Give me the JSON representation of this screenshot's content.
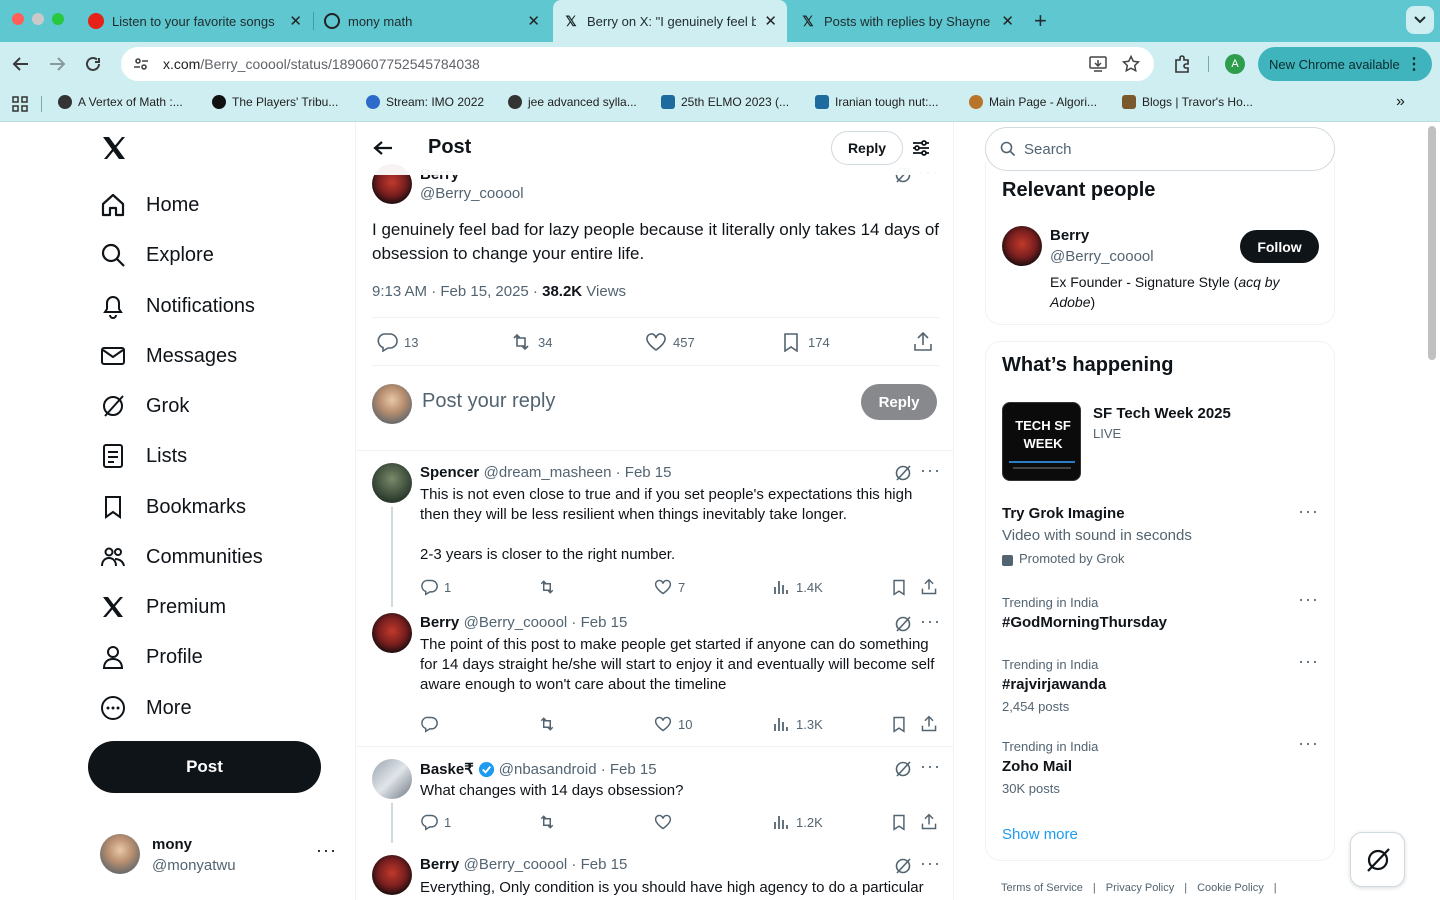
{
  "browser": {
    "tabs": [
      {
        "title": "Listen to your favorite songs"
      },
      {
        "title": "mony math"
      },
      {
        "title": "Berry on X: \"I genuinely feel b"
      },
      {
        "title": "Posts with replies by Shayne"
      }
    ],
    "url_host": "x.com",
    "url_path": "/Berry_cooool/status/1890607752545784038",
    "new_chrome_label": "New Chrome available",
    "profile_initial": "A",
    "bookmarks": [
      "A Vertex of Math :...",
      "The Players' Tribu...",
      "Stream: IMO 2022",
      "jee advanced sylla...",
      "25th ELMO 2023 (...",
      "Iranian tough nut:...",
      "Main Page - Algori...",
      "Blogs | Travor's Ho..."
    ]
  },
  "nav": {
    "items": [
      "Home",
      "Explore",
      "Notifications",
      "Messages",
      "Grok",
      "Lists",
      "Bookmarks",
      "Communities",
      "Premium",
      "Profile",
      "More"
    ],
    "post_label": "Post",
    "account_name": "mony",
    "account_handle": "@monyatwu"
  },
  "main": {
    "header_title": "Post",
    "header_reply": "Reply",
    "author_name": "Berry",
    "author_handle": "@Berry_cooool",
    "text": "I genuinely feel bad for lazy people because it literally only takes 14 days of obsession to change your entire life.",
    "meta_time": "9:13 AM · Feb 15, 2025 · ",
    "views_count": "38.2K",
    "views_label": " Views",
    "stats": {
      "replies": "13",
      "reposts": "34",
      "likes": "457",
      "bookmarks": "174"
    },
    "composer_placeholder": "Post your reply",
    "composer_button": "Reply",
    "replies": [
      {
        "name": "Spencer",
        "handle": "@dream_masheen · Feb 15",
        "text1": "This is not even close to true and if you set people's expectations this high then they will be less resilient when things inevitably take longer.",
        "text2": "2-3 years is closer to the right number.",
        "replies": "1",
        "reposts": "",
        "likes": "7",
        "views": "1.4K"
      },
      {
        "name": "Berry",
        "handle": "@Berry_cooool · Feb 15",
        "text1": "The point of this post to make people get started if anyone can do something for 14 days straight he/she will start to enjoy it and eventually will become self aware enough to won't care about the timeline",
        "replies": "",
        "reposts": "",
        "likes": "10",
        "views": "1.3K"
      },
      {
        "name": "Baske₹",
        "handle": "@nbasandroid · Feb 15",
        "text1": "What changes with 14 days obsession?",
        "replies": "1",
        "reposts": "",
        "likes": "",
        "views": "1.2K"
      },
      {
        "name": "Berry",
        "handle": "@Berry_cooool · Feb 15",
        "text1": "Everything, Only condition is you should have high agency to do a particular"
      }
    ]
  },
  "sidebar": {
    "search_placeholder": "Search",
    "relevant_title": "Relevant people",
    "person_name": "Berry",
    "person_handle": "@Berry_cooool",
    "person_bio_a": "Ex Founder - Signature Style (",
    "person_bio_b": "acq by Adobe",
    "person_bio_c": ")",
    "follow_label": "Follow",
    "happening_title": "What’s happening",
    "event_title": "SF Tech Week 2025",
    "event_status": "LIVE",
    "event_image_text": "TECH SF WEEK",
    "promo_title": "Try Grok Imagine",
    "promo_sub": "Video with sound in seconds",
    "promo_by": "Promoted by Grok",
    "trends": [
      {
        "context": "Trending in India",
        "name": "#GodMorningThursday",
        "posts": ""
      },
      {
        "context": "Trending in India",
        "name": "#rajvirjawanda",
        "posts": "2,454 posts"
      },
      {
        "context": "Trending in India",
        "name": "Zoho Mail",
        "posts": "30K posts"
      }
    ],
    "show_more": "Show more",
    "footer": [
      "Terms of Service",
      "Privacy Policy",
      "Cookie Policy"
    ]
  },
  "colors": {
    "accent": "#1d9bf0",
    "chrome": "#5fc7cf"
  }
}
